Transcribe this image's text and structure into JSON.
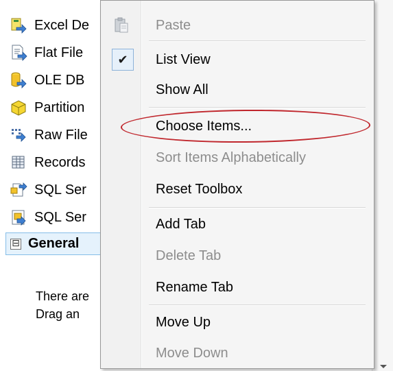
{
  "toolbox": {
    "items": [
      {
        "label": "Excel De",
        "icon": "excel-destination-icon"
      },
      {
        "label": "Flat File",
        "icon": "flat-file-icon"
      },
      {
        "label": "OLE DB",
        "icon": "ole-db-icon"
      },
      {
        "label": "Partition",
        "icon": "partition-icon"
      },
      {
        "label": "Raw File",
        "icon": "raw-file-icon"
      },
      {
        "label": "Records",
        "icon": "recordset-icon"
      },
      {
        "label": "SQL Ser",
        "icon": "sql-server-icon"
      },
      {
        "label": "SQL Ser",
        "icon": "sql-server-compact-icon"
      }
    ],
    "group": {
      "label": "General",
      "collapse_glyph": "⊟"
    },
    "empty_text": {
      "line1": "There are",
      "line2": "Drag an"
    }
  },
  "context_menu": {
    "items": [
      {
        "label": "Paste",
        "disabled": true,
        "icon": "paste-icon"
      },
      {
        "label": "List View",
        "checked": true,
        "icon": "checkmark-icon"
      },
      {
        "label": "Show All"
      },
      {
        "label": "Choose Items...",
        "highlighted_by_annotation": true
      },
      {
        "label": "Sort Items Alphabetically",
        "disabled": true
      },
      {
        "label": "Reset Toolbox"
      },
      {
        "label": "Add Tab"
      },
      {
        "label": "Delete Tab",
        "disabled": true
      },
      {
        "label": "Rename Tab"
      },
      {
        "label": "Move Up"
      },
      {
        "label": "Move Down",
        "disabled": true
      }
    ]
  },
  "colors": {
    "annotation_ellipse": "#c0272d",
    "group_header_bg": "#e5f2fc",
    "disabled_text": "#8d8d8d"
  }
}
